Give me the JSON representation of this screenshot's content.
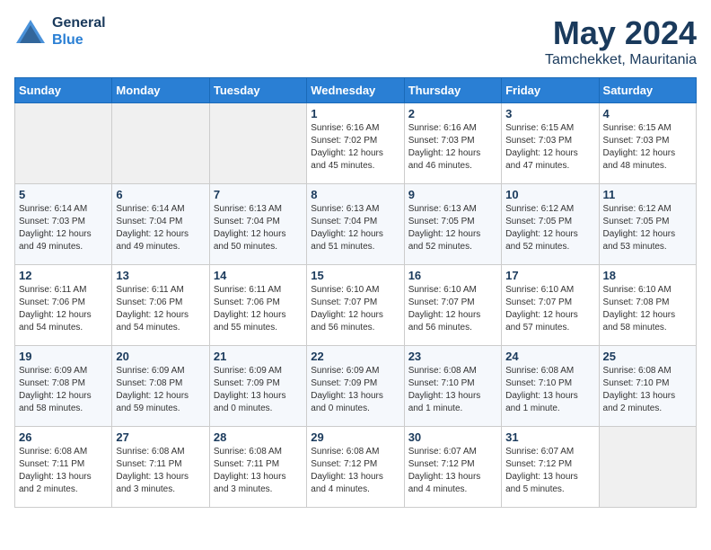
{
  "header": {
    "logo_line1": "General",
    "logo_line2": "Blue",
    "title": "May 2024",
    "subtitle": "Tamchekket, Mauritania"
  },
  "days_of_week": [
    "Sunday",
    "Monday",
    "Tuesday",
    "Wednesday",
    "Thursday",
    "Friday",
    "Saturday"
  ],
  "weeks": [
    [
      {
        "date": "",
        "empty": true
      },
      {
        "date": "",
        "empty": true
      },
      {
        "date": "",
        "empty": true
      },
      {
        "date": "1",
        "sunrise": "Sunrise: 6:16 AM",
        "sunset": "Sunset: 7:02 PM",
        "daylight": "Daylight: 12 hours and 45 minutes."
      },
      {
        "date": "2",
        "sunrise": "Sunrise: 6:16 AM",
        "sunset": "Sunset: 7:03 PM",
        "daylight": "Daylight: 12 hours and 46 minutes."
      },
      {
        "date": "3",
        "sunrise": "Sunrise: 6:15 AM",
        "sunset": "Sunset: 7:03 PM",
        "daylight": "Daylight: 12 hours and 47 minutes."
      },
      {
        "date": "4",
        "sunrise": "Sunrise: 6:15 AM",
        "sunset": "Sunset: 7:03 PM",
        "daylight": "Daylight: 12 hours and 48 minutes."
      }
    ],
    [
      {
        "date": "5",
        "sunrise": "Sunrise: 6:14 AM",
        "sunset": "Sunset: 7:03 PM",
        "daylight": "Daylight: 12 hours and 49 minutes."
      },
      {
        "date": "6",
        "sunrise": "Sunrise: 6:14 AM",
        "sunset": "Sunset: 7:04 PM",
        "daylight": "Daylight: 12 hours and 49 minutes."
      },
      {
        "date": "7",
        "sunrise": "Sunrise: 6:13 AM",
        "sunset": "Sunset: 7:04 PM",
        "daylight": "Daylight: 12 hours and 50 minutes."
      },
      {
        "date": "8",
        "sunrise": "Sunrise: 6:13 AM",
        "sunset": "Sunset: 7:04 PM",
        "daylight": "Daylight: 12 hours and 51 minutes."
      },
      {
        "date": "9",
        "sunrise": "Sunrise: 6:13 AM",
        "sunset": "Sunset: 7:05 PM",
        "daylight": "Daylight: 12 hours and 52 minutes."
      },
      {
        "date": "10",
        "sunrise": "Sunrise: 6:12 AM",
        "sunset": "Sunset: 7:05 PM",
        "daylight": "Daylight: 12 hours and 52 minutes."
      },
      {
        "date": "11",
        "sunrise": "Sunrise: 6:12 AM",
        "sunset": "Sunset: 7:05 PM",
        "daylight": "Daylight: 12 hours and 53 minutes."
      }
    ],
    [
      {
        "date": "12",
        "sunrise": "Sunrise: 6:11 AM",
        "sunset": "Sunset: 7:06 PM",
        "daylight": "Daylight: 12 hours and 54 minutes."
      },
      {
        "date": "13",
        "sunrise": "Sunrise: 6:11 AM",
        "sunset": "Sunset: 7:06 PM",
        "daylight": "Daylight: 12 hours and 54 minutes."
      },
      {
        "date": "14",
        "sunrise": "Sunrise: 6:11 AM",
        "sunset": "Sunset: 7:06 PM",
        "daylight": "Daylight: 12 hours and 55 minutes."
      },
      {
        "date": "15",
        "sunrise": "Sunrise: 6:10 AM",
        "sunset": "Sunset: 7:07 PM",
        "daylight": "Daylight: 12 hours and 56 minutes."
      },
      {
        "date": "16",
        "sunrise": "Sunrise: 6:10 AM",
        "sunset": "Sunset: 7:07 PM",
        "daylight": "Daylight: 12 hours and 56 minutes."
      },
      {
        "date": "17",
        "sunrise": "Sunrise: 6:10 AM",
        "sunset": "Sunset: 7:07 PM",
        "daylight": "Daylight: 12 hours and 57 minutes."
      },
      {
        "date": "18",
        "sunrise": "Sunrise: 6:10 AM",
        "sunset": "Sunset: 7:08 PM",
        "daylight": "Daylight: 12 hours and 58 minutes."
      }
    ],
    [
      {
        "date": "19",
        "sunrise": "Sunrise: 6:09 AM",
        "sunset": "Sunset: 7:08 PM",
        "daylight": "Daylight: 12 hours and 58 minutes."
      },
      {
        "date": "20",
        "sunrise": "Sunrise: 6:09 AM",
        "sunset": "Sunset: 7:08 PM",
        "daylight": "Daylight: 12 hours and 59 minutes."
      },
      {
        "date": "21",
        "sunrise": "Sunrise: 6:09 AM",
        "sunset": "Sunset: 7:09 PM",
        "daylight": "Daylight: 13 hours and 0 minutes."
      },
      {
        "date": "22",
        "sunrise": "Sunrise: 6:09 AM",
        "sunset": "Sunset: 7:09 PM",
        "daylight": "Daylight: 13 hours and 0 minutes."
      },
      {
        "date": "23",
        "sunrise": "Sunrise: 6:08 AM",
        "sunset": "Sunset: 7:10 PM",
        "daylight": "Daylight: 13 hours and 1 minute."
      },
      {
        "date": "24",
        "sunrise": "Sunrise: 6:08 AM",
        "sunset": "Sunset: 7:10 PM",
        "daylight": "Daylight: 13 hours and 1 minute."
      },
      {
        "date": "25",
        "sunrise": "Sunrise: 6:08 AM",
        "sunset": "Sunset: 7:10 PM",
        "daylight": "Daylight: 13 hours and 2 minutes."
      }
    ],
    [
      {
        "date": "26",
        "sunrise": "Sunrise: 6:08 AM",
        "sunset": "Sunset: 7:11 PM",
        "daylight": "Daylight: 13 hours and 2 minutes."
      },
      {
        "date": "27",
        "sunrise": "Sunrise: 6:08 AM",
        "sunset": "Sunset: 7:11 PM",
        "daylight": "Daylight: 13 hours and 3 minutes."
      },
      {
        "date": "28",
        "sunrise": "Sunrise: 6:08 AM",
        "sunset": "Sunset: 7:11 PM",
        "daylight": "Daylight: 13 hours and 3 minutes."
      },
      {
        "date": "29",
        "sunrise": "Sunrise: 6:08 AM",
        "sunset": "Sunset: 7:12 PM",
        "daylight": "Daylight: 13 hours and 4 minutes."
      },
      {
        "date": "30",
        "sunrise": "Sunrise: 6:07 AM",
        "sunset": "Sunset: 7:12 PM",
        "daylight": "Daylight: 13 hours and 4 minutes."
      },
      {
        "date": "31",
        "sunrise": "Sunrise: 6:07 AM",
        "sunset": "Sunset: 7:12 PM",
        "daylight": "Daylight: 13 hours and 5 minutes."
      },
      {
        "date": "",
        "empty": true
      }
    ]
  ]
}
